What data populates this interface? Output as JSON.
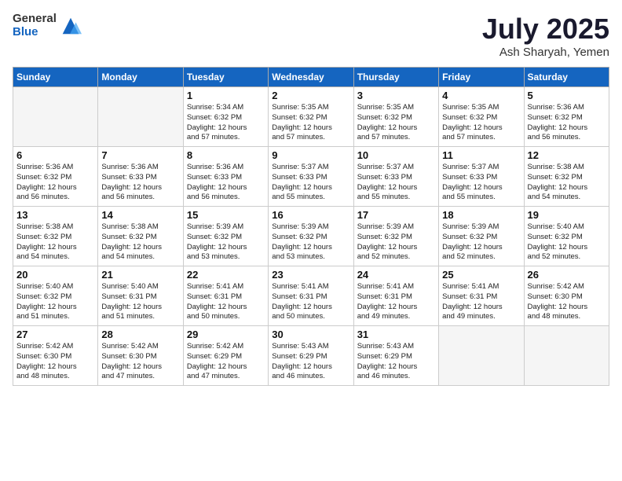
{
  "logo": {
    "general": "General",
    "blue": "Blue"
  },
  "title": "July 2025",
  "location": "Ash Sharyah, Yemen",
  "days_of_week": [
    "Sunday",
    "Monday",
    "Tuesday",
    "Wednesday",
    "Thursday",
    "Friday",
    "Saturday"
  ],
  "weeks": [
    [
      {
        "day": "",
        "info": ""
      },
      {
        "day": "",
        "info": ""
      },
      {
        "day": "1",
        "info": "Sunrise: 5:34 AM\nSunset: 6:32 PM\nDaylight: 12 hours\nand 57 minutes."
      },
      {
        "day": "2",
        "info": "Sunrise: 5:35 AM\nSunset: 6:32 PM\nDaylight: 12 hours\nand 57 minutes."
      },
      {
        "day": "3",
        "info": "Sunrise: 5:35 AM\nSunset: 6:32 PM\nDaylight: 12 hours\nand 57 minutes."
      },
      {
        "day": "4",
        "info": "Sunrise: 5:35 AM\nSunset: 6:32 PM\nDaylight: 12 hours\nand 57 minutes."
      },
      {
        "day": "5",
        "info": "Sunrise: 5:36 AM\nSunset: 6:32 PM\nDaylight: 12 hours\nand 56 minutes."
      }
    ],
    [
      {
        "day": "6",
        "info": "Sunrise: 5:36 AM\nSunset: 6:32 PM\nDaylight: 12 hours\nand 56 minutes."
      },
      {
        "day": "7",
        "info": "Sunrise: 5:36 AM\nSunset: 6:33 PM\nDaylight: 12 hours\nand 56 minutes."
      },
      {
        "day": "8",
        "info": "Sunrise: 5:36 AM\nSunset: 6:33 PM\nDaylight: 12 hours\nand 56 minutes."
      },
      {
        "day": "9",
        "info": "Sunrise: 5:37 AM\nSunset: 6:33 PM\nDaylight: 12 hours\nand 55 minutes."
      },
      {
        "day": "10",
        "info": "Sunrise: 5:37 AM\nSunset: 6:33 PM\nDaylight: 12 hours\nand 55 minutes."
      },
      {
        "day": "11",
        "info": "Sunrise: 5:37 AM\nSunset: 6:33 PM\nDaylight: 12 hours\nand 55 minutes."
      },
      {
        "day": "12",
        "info": "Sunrise: 5:38 AM\nSunset: 6:32 PM\nDaylight: 12 hours\nand 54 minutes."
      }
    ],
    [
      {
        "day": "13",
        "info": "Sunrise: 5:38 AM\nSunset: 6:32 PM\nDaylight: 12 hours\nand 54 minutes."
      },
      {
        "day": "14",
        "info": "Sunrise: 5:38 AM\nSunset: 6:32 PM\nDaylight: 12 hours\nand 54 minutes."
      },
      {
        "day": "15",
        "info": "Sunrise: 5:39 AM\nSunset: 6:32 PM\nDaylight: 12 hours\nand 53 minutes."
      },
      {
        "day": "16",
        "info": "Sunrise: 5:39 AM\nSunset: 6:32 PM\nDaylight: 12 hours\nand 53 minutes."
      },
      {
        "day": "17",
        "info": "Sunrise: 5:39 AM\nSunset: 6:32 PM\nDaylight: 12 hours\nand 52 minutes."
      },
      {
        "day": "18",
        "info": "Sunrise: 5:39 AM\nSunset: 6:32 PM\nDaylight: 12 hours\nand 52 minutes."
      },
      {
        "day": "19",
        "info": "Sunrise: 5:40 AM\nSunset: 6:32 PM\nDaylight: 12 hours\nand 52 minutes."
      }
    ],
    [
      {
        "day": "20",
        "info": "Sunrise: 5:40 AM\nSunset: 6:32 PM\nDaylight: 12 hours\nand 51 minutes."
      },
      {
        "day": "21",
        "info": "Sunrise: 5:40 AM\nSunset: 6:31 PM\nDaylight: 12 hours\nand 51 minutes."
      },
      {
        "day": "22",
        "info": "Sunrise: 5:41 AM\nSunset: 6:31 PM\nDaylight: 12 hours\nand 50 minutes."
      },
      {
        "day": "23",
        "info": "Sunrise: 5:41 AM\nSunset: 6:31 PM\nDaylight: 12 hours\nand 50 minutes."
      },
      {
        "day": "24",
        "info": "Sunrise: 5:41 AM\nSunset: 6:31 PM\nDaylight: 12 hours\nand 49 minutes."
      },
      {
        "day": "25",
        "info": "Sunrise: 5:41 AM\nSunset: 6:31 PM\nDaylight: 12 hours\nand 49 minutes."
      },
      {
        "day": "26",
        "info": "Sunrise: 5:42 AM\nSunset: 6:30 PM\nDaylight: 12 hours\nand 48 minutes."
      }
    ],
    [
      {
        "day": "27",
        "info": "Sunrise: 5:42 AM\nSunset: 6:30 PM\nDaylight: 12 hours\nand 48 minutes."
      },
      {
        "day": "28",
        "info": "Sunrise: 5:42 AM\nSunset: 6:30 PM\nDaylight: 12 hours\nand 47 minutes."
      },
      {
        "day": "29",
        "info": "Sunrise: 5:42 AM\nSunset: 6:29 PM\nDaylight: 12 hours\nand 47 minutes."
      },
      {
        "day": "30",
        "info": "Sunrise: 5:43 AM\nSunset: 6:29 PM\nDaylight: 12 hours\nand 46 minutes."
      },
      {
        "day": "31",
        "info": "Sunrise: 5:43 AM\nSunset: 6:29 PM\nDaylight: 12 hours\nand 46 minutes."
      },
      {
        "day": "",
        "info": ""
      },
      {
        "day": "",
        "info": ""
      }
    ]
  ]
}
